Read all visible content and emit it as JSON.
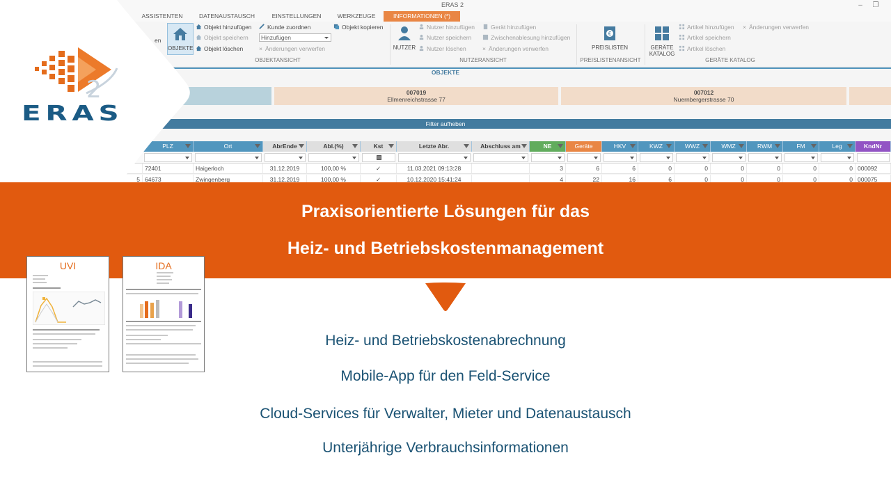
{
  "app": {
    "window_title": "ERAS 2",
    "menu_tabs": [
      "ASSISTENTEN",
      "DATENAUSTAUSCH",
      "EINSTELLUNGEN",
      "WERKZEUGE",
      "INFORMATIONEN (*)"
    ],
    "ribbon": {
      "objekte_button": "OBJEKTE",
      "partial_label": "en",
      "objekt_hinzufuegen": "Objekt hinzufügen",
      "objekt_speichern": "Objekt speichern",
      "objekt_loeschen": "Objekt löschen",
      "kunde_zuordnen": "Kunde zuordnen",
      "kunde_combo": "Hinzufügen",
      "aenderungen_verwerfen": "Änderungen verwerfen",
      "objekt_kopieren": "Objekt kopieren",
      "group_objektansicht": "OBJEKTANSICHT",
      "nutzer_button": "NUTZER",
      "nutzer_hinzufuegen": "Nutzer hinzufügen",
      "nutzer_speichern": "Nutzer speichern",
      "nutzer_loeschen": "Nutzer löschen",
      "geraet_hinzufuegen": "Gerät hinzufügen",
      "zwischenablesung": "Zwischenablesung hinzufügen",
      "nutzer_aenderungen_verwerfen": "Änderungen verwerfen",
      "group_nutzeransicht": "NUTZERANSICHT",
      "preislisten_button": "PREISLISTEN",
      "group_preislistenansicht": "PREISLISTENANSICHT",
      "geraete_katalog_line1": "GERÄTE",
      "geraete_katalog_line2": "KATALOG",
      "artikel_hinzufuegen": "Artikel hinzufügen",
      "artikel_speichern": "Artikel speichern",
      "artikel_loeschen": "Artikel löschen",
      "artikel_aenderungen_verwerfen": "Änderungen verwerfen",
      "group_geraete_katalog": "GERÄTE KATALOG"
    },
    "section_title": "OBJEKTE",
    "objects": [
      {
        "num": "007019",
        "address": "Ellmenreichstrasse 77"
      },
      {
        "num": "007012",
        "address": "Nuernbergerstrasse 70"
      }
    ],
    "filter_label": "Filter aufheben",
    "grid": {
      "columns": [
        "PLZ",
        "Ort",
        "AbrEnde",
        "Abl.(%)",
        "Kst",
        "Letzte Abr.",
        "Abschluss am",
        "NE",
        "Geräte",
        "HKV",
        "KWZ",
        "WWZ",
        "WMZ",
        "RWM",
        "FM",
        "Leg",
        "KndNr"
      ],
      "rows": [
        {
          "pre": "",
          "plz": "72401",
          "ort": "Haigerloch",
          "abrende": "31.12.2019",
          "abl": "100,00 %",
          "kst": "✓",
          "letzte": "11.03.2021 09:13:28",
          "abschluss": "",
          "ne": "3",
          "geraete": "6",
          "hkv": "6",
          "kwz": "0",
          "wwz": "0",
          "wmz": "0",
          "rwm": "0",
          "fm": "0",
          "leg": "0",
          "knd": "000092"
        },
        {
          "pre": "5",
          "plz": "64673",
          "ort": "Zwingenberg",
          "abrende": "31.12.2019",
          "abl": "100,00 %",
          "kst": "✓",
          "letzte": "10.12.2020 15:41:24",
          "abschluss": "",
          "ne": "4",
          "geraete": "22",
          "hkv": "16",
          "kwz": "6",
          "wwz": "0",
          "wmz": "0",
          "rwm": "0",
          "fm": "0",
          "leg": "0",
          "knd": "000075"
        }
      ]
    }
  },
  "logo": {
    "word": "ERAS",
    "superscript": "2"
  },
  "banner": {
    "line1": "Praxisorientierte Lösungen für das",
    "line2": "Heiz- und Betriebskostenmanagement"
  },
  "thumbs": [
    {
      "label": "UVI"
    },
    {
      "label": "IDA"
    }
  ],
  "features": [
    "Heiz- und Betriebskostenabrechnung",
    "Mobile-App für den Feld-Service",
    "Cloud-Services für Verwalter, Mieter und Datenaustausch",
    "Unterjährige Verbrauchsinformationen"
  ],
  "colors": {
    "banner_orange": "#e15a0f",
    "accent_orange": "#e46c1c",
    "brand_blue": "#1b5b85",
    "text_blue": "#1a5273"
  }
}
